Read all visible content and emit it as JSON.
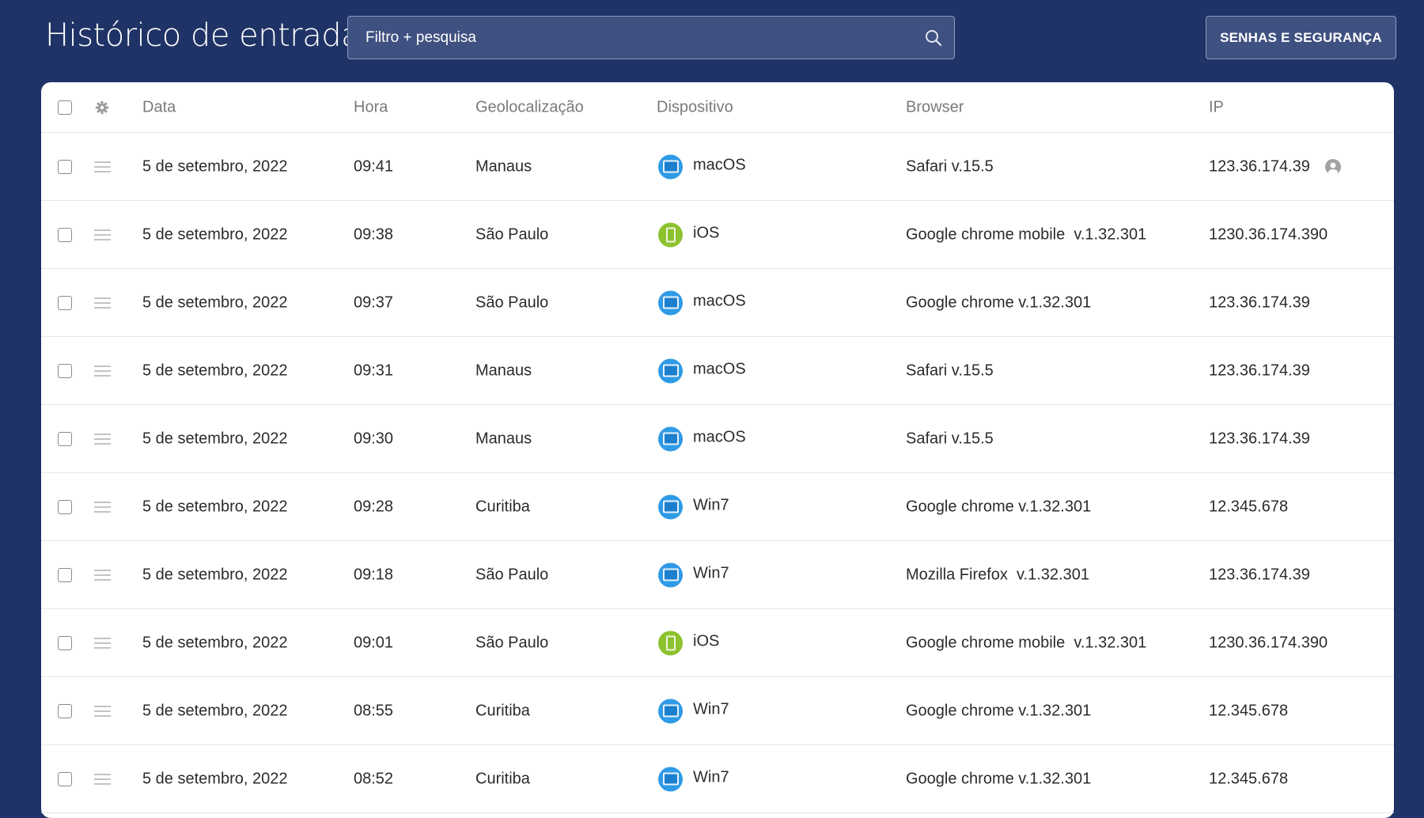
{
  "header": {
    "title": "Histórico de entradas",
    "search_placeholder": "Filtro + pesquisa",
    "security_button": "SENHAS E SEGURANÇA"
  },
  "table": {
    "columns": {
      "date": "Data",
      "time": "Hora",
      "geo": "Geolocalização",
      "device": "Dispositivo",
      "browser": "Browser",
      "ip": "IP"
    },
    "rows": [
      {
        "date": "5 de setembro, 2022",
        "time": "09:41",
        "geo": "Manaus",
        "device": "macOS",
        "device_type": "laptop",
        "browser": "Safari v.15.5",
        "ip": "123.36.174.39",
        "current_user": true
      },
      {
        "date": "5 de setembro, 2022",
        "time": "09:38",
        "geo": "São Paulo",
        "device": "iOS",
        "device_type": "phone",
        "browser": "Google chrome mobile  v.1.32.301",
        "ip": "1230.36.174.390"
      },
      {
        "date": "5 de setembro, 2022",
        "time": "09:37",
        "geo": "São Paulo",
        "device": "macOS",
        "device_type": "laptop",
        "browser": "Google chrome v.1.32.301",
        "ip": "123.36.174.39"
      },
      {
        "date": "5 de setembro, 2022",
        "time": "09:31",
        "geo": "Manaus",
        "device": "macOS",
        "device_type": "laptop",
        "browser": "Safari v.15.5",
        "ip": "123.36.174.39"
      },
      {
        "date": "5 de setembro, 2022",
        "time": "09:30",
        "geo": "Manaus",
        "device": "macOS",
        "device_type": "laptop",
        "browser": "Safari v.15.5",
        "ip": "123.36.174.39"
      },
      {
        "date": "5 de setembro, 2022",
        "time": "09:28",
        "geo": "Curitiba",
        "device": "Win7",
        "device_type": "laptop",
        "browser": "Google chrome v.1.32.301",
        "ip": "12.345.678"
      },
      {
        "date": "5 de setembro, 2022",
        "time": "09:18",
        "geo": "São Paulo",
        "device": "Win7",
        "device_type": "laptop",
        "browser": "Mozilla Firefox  v.1.32.301",
        "ip": "123.36.174.39"
      },
      {
        "date": "5 de setembro, 2022",
        "time": "09:01",
        "geo": "São Paulo",
        "device": "iOS",
        "device_type": "phone",
        "browser": "Google chrome mobile  v.1.32.301",
        "ip": "1230.36.174.390"
      },
      {
        "date": "5 de setembro, 2022",
        "time": "08:55",
        "geo": "Curitiba",
        "device": "Win7",
        "device_type": "laptop",
        "browser": "Google chrome v.1.32.301",
        "ip": "12.345.678"
      },
      {
        "date": "5 de setembro, 2022",
        "time": "08:52",
        "geo": "Curitiba",
        "device": "Win7",
        "device_type": "laptop",
        "browser": "Google chrome v.1.32.301",
        "ip": "12.345.678"
      }
    ]
  },
  "colors": {
    "background": "#1f3366",
    "laptop_icon": "#2f9be6",
    "phone_icon": "#8dc22f"
  }
}
